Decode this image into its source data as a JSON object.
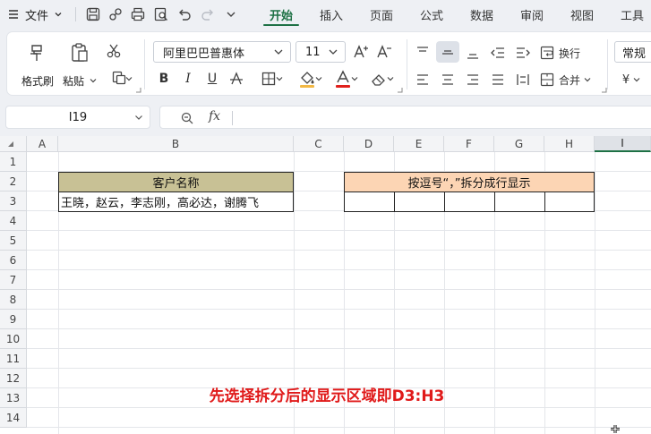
{
  "menu": {
    "hamburger_icon": "hamburger-icon",
    "file_label": "文件",
    "quick_access": [
      "save-icon",
      "share-icon",
      "print-icon",
      "print-preview-icon",
      "undo-icon",
      "redo-icon",
      "more-icon"
    ],
    "tabs": [
      {
        "label": "开始",
        "active": true
      },
      {
        "label": "插入",
        "active": false
      },
      {
        "label": "页面",
        "active": false
      },
      {
        "label": "公式",
        "active": false
      },
      {
        "label": "数据",
        "active": false
      },
      {
        "label": "审阅",
        "active": false
      },
      {
        "label": "视图",
        "active": false
      },
      {
        "label": "工具",
        "active": false
      }
    ]
  },
  "ribbon": {
    "format_painter_label": "格式刷",
    "paste_label": "粘贴",
    "font_name": "阿里巴巴普惠体",
    "font_size": "11",
    "wrap_text_label": "换行",
    "merge_label": "合并",
    "number_format": "常规",
    "currency_symbol": "¥",
    "font_color": "#e0201c",
    "fill_color": "#f2b844"
  },
  "formula_bar": {
    "name_box": "I19",
    "formula": ""
  },
  "sheet": {
    "columns": [
      "A",
      "B",
      "C",
      "D",
      "E",
      "F",
      "G",
      "H",
      "I"
    ],
    "rows": [
      "1",
      "2",
      "3",
      "4",
      "5",
      "6",
      "7",
      "8",
      "9",
      "10",
      "11",
      "12",
      "13",
      "14"
    ],
    "b2": "客户名称",
    "b3": "王晓，赵云，李志刚，高必达，谢腾飞",
    "d2": "按逗号“，”拆分成行显示",
    "annotation": "先选择拆分后的显示区域即D3:H3",
    "annotation_color": "#e01a1a",
    "b2_fill": "#c8c195",
    "d2_fill": "#fcd5b4",
    "accent": "#1e7145"
  }
}
